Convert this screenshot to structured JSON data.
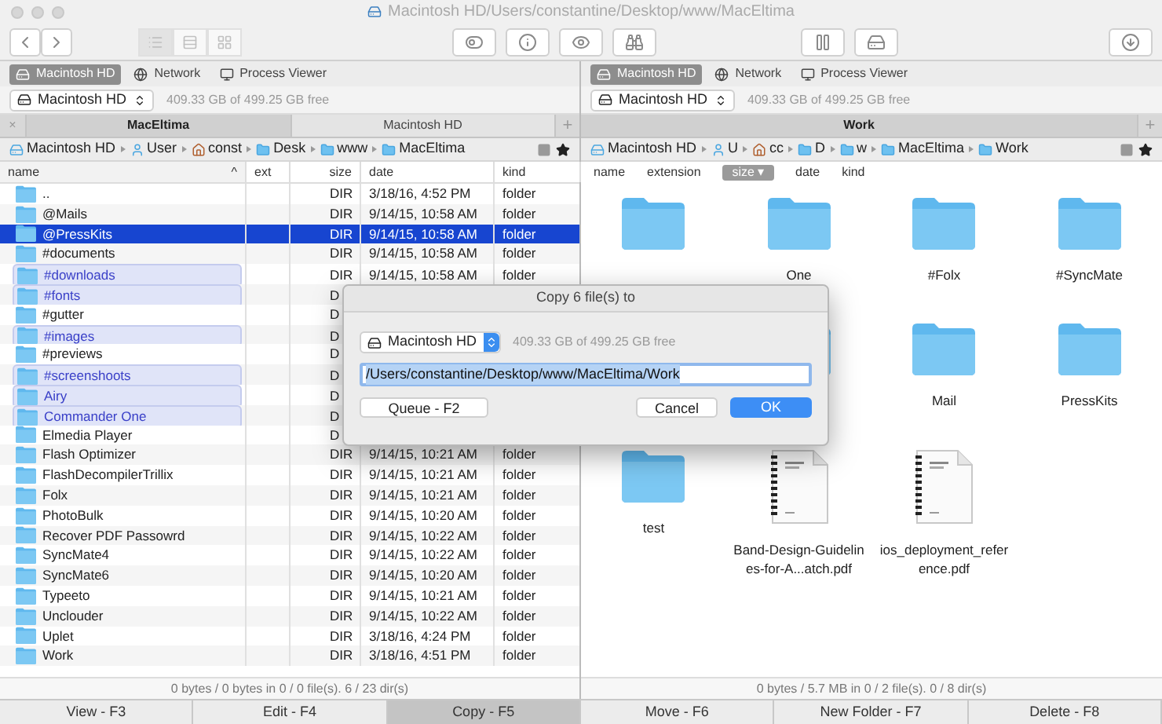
{
  "window": {
    "title": "Macintosh HD/Users/constantine/Desktop/www/MacEltima"
  },
  "view_modes": [
    {
      "kind": "list",
      "selected": true
    },
    {
      "kind": "details",
      "selected": false
    },
    {
      "kind": "grid",
      "selected": false
    }
  ],
  "left": {
    "drive_tabs": [
      {
        "kind": "drive",
        "label": "Macintosh HD",
        "selected": true
      },
      {
        "kind": "network",
        "label": "Network",
        "selected": false
      },
      {
        "kind": "process",
        "label": "Process Viewer",
        "selected": false
      }
    ],
    "drive": {
      "name": "Macintosh HD",
      "free": "409.33 GB of 499.25 GB free"
    },
    "tabs": [
      {
        "label": "MacEltima",
        "selected": true
      },
      {
        "label": "Macintosh HD",
        "selected": false
      }
    ],
    "close_tab": "×",
    "add_tab": "+",
    "breadcrumb": [
      {
        "kind": "drive",
        "label": "Macintosh HD"
      },
      {
        "kind": "user",
        "label": "User"
      },
      {
        "kind": "home",
        "label": "const"
      },
      {
        "kind": "folder",
        "label": "Desk"
      },
      {
        "kind": "folder",
        "label": "www"
      },
      {
        "kind": "folder",
        "label": "MacEltima"
      }
    ],
    "columns": [
      {
        "label": "name",
        "sorted": true
      },
      {
        "label": "ext",
        "sorted": false
      },
      {
        "label": "size",
        "sorted": false
      },
      {
        "label": "date",
        "sorted": false
      },
      {
        "label": "kind",
        "sorted": false
      }
    ],
    "sort_mark": "^",
    "rows": [
      {
        "name": "..",
        "size": "DIR",
        "date": "3/18/16, 4:52 PM",
        "kind": "folder",
        "selected": false,
        "marked": false
      },
      {
        "name": "@Mails",
        "size": "DIR",
        "date": "9/14/15, 10:58 AM",
        "kind": "folder",
        "selected": false,
        "marked": false
      },
      {
        "name": "@PressKits",
        "size": "DIR",
        "date": "9/14/15, 10:58 AM",
        "kind": "folder",
        "selected": true,
        "marked": false
      },
      {
        "name": "#documents",
        "size": "DIR",
        "date": "9/14/15, 10:58 AM",
        "kind": "folder",
        "selected": false,
        "marked": false
      },
      {
        "name": "#downloads",
        "size": "DIR",
        "date": "9/14/15, 10:58 AM",
        "kind": "folder",
        "selected": false,
        "marked": true
      },
      {
        "name": "#fonts",
        "size": "D",
        "selected": false,
        "marked": true
      },
      {
        "name": "#gutter",
        "size": "D",
        "selected": false,
        "marked": false
      },
      {
        "name": "#images",
        "size": "D",
        "selected": false,
        "marked": true
      },
      {
        "name": "#previews",
        "size": "D",
        "selected": false,
        "marked": false
      },
      {
        "name": "#screenshoots",
        "size": "D",
        "selected": false,
        "marked": true
      },
      {
        "name": "Airy",
        "size": "D",
        "selected": false,
        "marked": true
      },
      {
        "name": "Commander One",
        "size": "D",
        "selected": false,
        "marked": true
      },
      {
        "name": "Elmedia Player",
        "size": "D",
        "selected": false,
        "marked": false
      },
      {
        "name": "Flash Optimizer",
        "size": "DIR",
        "date": "9/14/15, 10:21 AM",
        "kind": "folder",
        "selected": false,
        "marked": false
      },
      {
        "name": "FlashDecompilerTrillix",
        "size": "DIR",
        "date": "9/14/15, 10:21 AM",
        "kind": "folder",
        "selected": false,
        "marked": false
      },
      {
        "name": "Folx",
        "size": "DIR",
        "date": "9/14/15, 10:21 AM",
        "kind": "folder",
        "selected": false,
        "marked": false
      },
      {
        "name": "PhotoBulk",
        "size": "DIR",
        "date": "9/14/15, 10:20 AM",
        "kind": "folder",
        "selected": false,
        "marked": false
      },
      {
        "name": "Recover PDF Passowrd",
        "size": "DIR",
        "date": "9/14/15, 10:22 AM",
        "kind": "folder",
        "selected": false,
        "marked": false
      },
      {
        "name": "SyncMate4",
        "size": "DIR",
        "date": "9/14/15, 10:22 AM",
        "kind": "folder",
        "selected": false,
        "marked": false
      },
      {
        "name": "SyncMate6",
        "size": "DIR",
        "date": "9/14/15, 10:20 AM",
        "kind": "folder",
        "selected": false,
        "marked": false
      },
      {
        "name": "Typeeto",
        "size": "DIR",
        "date": "9/14/15, 10:21 AM",
        "kind": "folder",
        "selected": false,
        "marked": false
      },
      {
        "name": "Unclouder",
        "size": "DIR",
        "date": "9/14/15, 10:22 AM",
        "kind": "folder",
        "selected": false,
        "marked": false
      },
      {
        "name": "Uplet",
        "size": "DIR",
        "date": "3/18/16, 4:24 PM",
        "kind": "folder",
        "selected": false,
        "marked": false
      },
      {
        "name": "Work",
        "size": "DIR",
        "date": "3/18/16, 4:51 PM",
        "kind": "folder",
        "selected": false,
        "marked": false
      }
    ],
    "status": "0 bytes / 0 bytes in 0 / 0 file(s). 6 / 23 dir(s)"
  },
  "right": {
    "drive_tabs": [
      {
        "kind": "drive",
        "label": "Macintosh HD",
        "selected": true
      },
      {
        "kind": "network",
        "label": "Network",
        "selected": false
      },
      {
        "kind": "process",
        "label": "Process Viewer",
        "selected": false
      }
    ],
    "drive": {
      "name": "Macintosh HD",
      "free": "409.33 GB of 499.25 GB free"
    },
    "tabs": [
      {
        "label": "Work",
        "selected": true
      }
    ],
    "add_tab": "+",
    "breadcrumb": [
      {
        "kind": "drive",
        "label": "Macintosh HD"
      },
      {
        "kind": "user",
        "label": "U"
      },
      {
        "kind": "home",
        "label": "cc"
      },
      {
        "kind": "folder",
        "label": "D"
      },
      {
        "kind": "folder",
        "label": "w"
      },
      {
        "kind": "folder",
        "label": "MacEltima"
      },
      {
        "kind": "folder",
        "label": "Work"
      }
    ],
    "columns": [
      {
        "label": "name",
        "sorted": false
      },
      {
        "label": "extension",
        "sorted": false
      },
      {
        "label": "size",
        "sorted": true
      },
      {
        "label": "date",
        "sorted": false
      },
      {
        "label": "kind",
        "sorted": false
      }
    ],
    "sort_mark": "▾",
    "items": [
      {
        "kind": "folder"
      },
      {
        "kind": "folder",
        "label": "One"
      },
      {
        "kind": "folder",
        "label": "#Folx"
      },
      {
        "kind": "folder",
        "label": "#SyncMate"
      },
      {
        "kind": "folder"
      },
      {
        "kind": "folder",
        "label": "Mail"
      },
      {
        "kind": "folder",
        "label": "PressKits"
      },
      {
        "kind": "folder",
        "label": "test"
      },
      {
        "kind": "pdf",
        "label": "Band-Design-Guidelines-for-A...atch.pdf"
      },
      {
        "kind": "pdf",
        "label": "ios_deployment_reference.pdf"
      }
    ],
    "status": "0 bytes / 5.7 MB in 0 / 2 file(s). 0 / 8 dir(s)"
  },
  "function_keys": [
    {
      "label": "View - F3",
      "selected": false
    },
    {
      "label": "Edit - F4",
      "selected": false
    },
    {
      "label": "Copy - F5",
      "selected": true
    },
    {
      "label": "Move - F6",
      "selected": false
    },
    {
      "label": "New Folder - F7",
      "selected": false
    },
    {
      "label": "Delete - F8",
      "selected": false
    }
  ],
  "dialog": {
    "title": "Copy 6 file(s) to",
    "drive": "Macintosh HD",
    "free": "409.33 GB of 499.25 GB free",
    "path": "/Users/constantine/Desktop/www/MacEltima/Work",
    "buttons": [
      {
        "label": "Queue - F2",
        "default": false
      },
      {
        "label": "Cancel",
        "default": false
      },
      {
        "label": "OK",
        "default": true
      }
    ]
  }
}
